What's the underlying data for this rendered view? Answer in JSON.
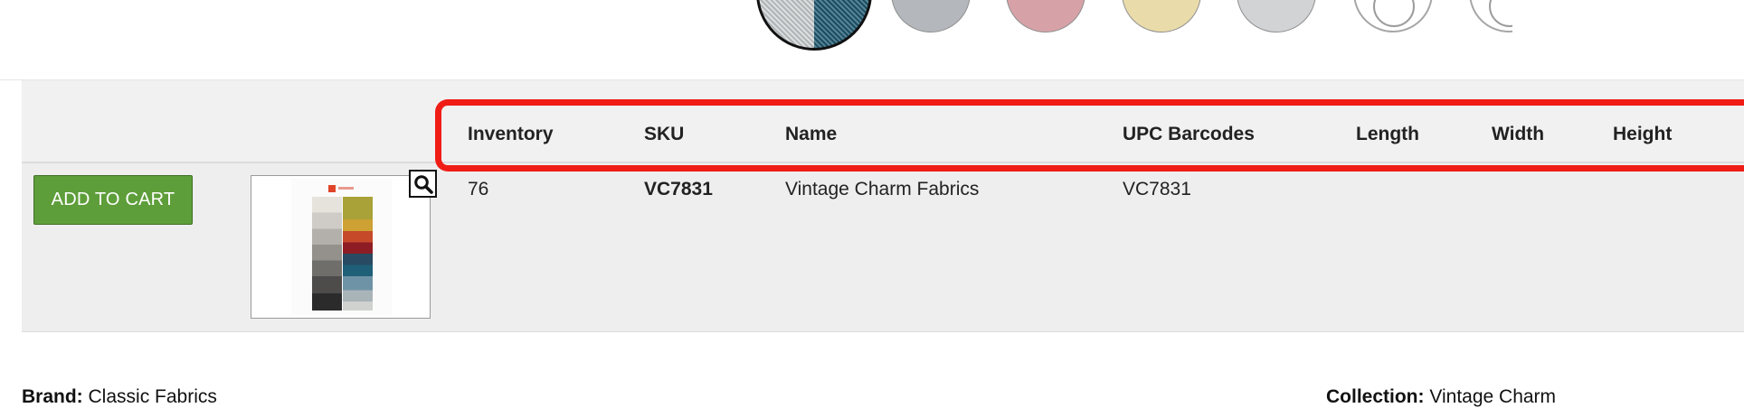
{
  "swatches": [
    {
      "name": "selected",
      "color": "#2d3b4a"
    },
    {
      "name": "grey",
      "color": "#b4b7bc"
    },
    {
      "name": "rose",
      "color": "#d7a2a7"
    },
    {
      "name": "sand",
      "color": "#eadcaa"
    },
    {
      "name": "light-grey",
      "color": "#d2d3d5"
    },
    {
      "name": "white",
      "color": "#ffffff"
    },
    {
      "name": "white",
      "color": "#ffffff"
    }
  ],
  "table": {
    "headers": {
      "inventory": "Inventory",
      "sku": "SKU",
      "name": "Name",
      "upc": "UPC Barcodes",
      "length": "Length",
      "width": "Width",
      "height": "Height"
    },
    "row": {
      "add_to_cart": "ADD TO CART",
      "inventory": "76",
      "sku": "VC7831",
      "name": "Vintage Charm Fabrics",
      "upc": "VC7831",
      "length": "",
      "width": "",
      "height": ""
    }
  },
  "details": {
    "brand_label": "Brand:",
    "brand_value": "Classic Fabrics",
    "collection_label": "Collection:",
    "collection_value": "Vintage Charm"
  },
  "colors": {
    "accent_button": "#5e9e3a",
    "highlight": "#f01d16"
  },
  "icons": {
    "zoom": "magnifier-icon"
  }
}
